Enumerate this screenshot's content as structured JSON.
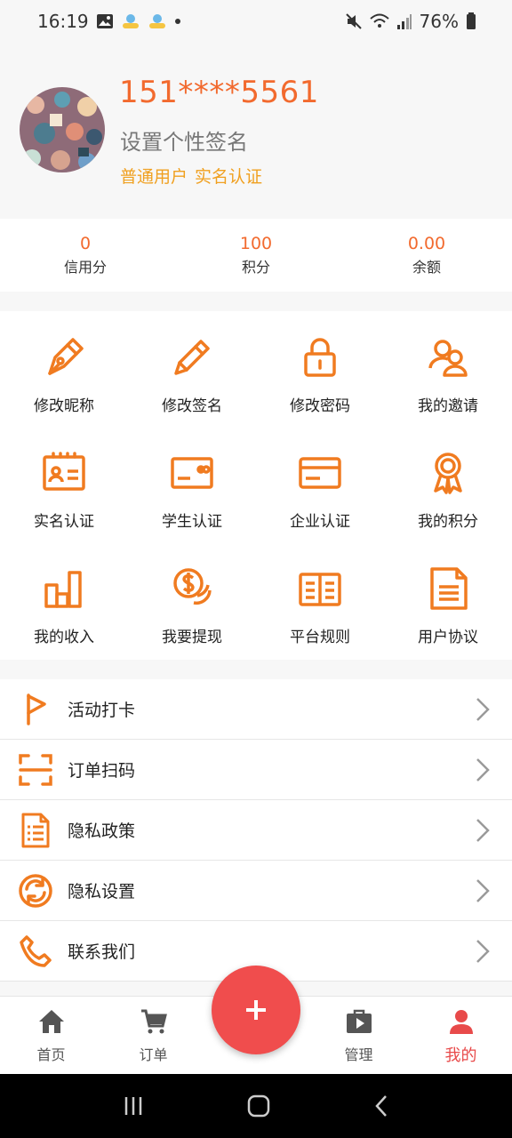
{
  "status_bar": {
    "time": "16:19",
    "battery": "76%"
  },
  "profile": {
    "phone": "151****5561",
    "signature": "设置个性签名",
    "user_type": "普通用户",
    "verify": "实名认证"
  },
  "stats": [
    {
      "value": "0",
      "label": "信用分"
    },
    {
      "value": "100",
      "label": "积分"
    },
    {
      "value": "0.00",
      "label": "余额"
    }
  ],
  "grid": [
    {
      "label": "修改昵称",
      "icon": "pen-nib-icon"
    },
    {
      "label": "修改签名",
      "icon": "pencil-icon"
    },
    {
      "label": "修改密码",
      "icon": "lock-icon"
    },
    {
      "label": "我的邀请",
      "icon": "users-icon"
    },
    {
      "label": "实名认证",
      "icon": "id-card-icon"
    },
    {
      "label": "学生认证",
      "icon": "student-card-icon"
    },
    {
      "label": "企业认证",
      "icon": "credit-card-icon"
    },
    {
      "label": "我的积分",
      "icon": "medal-icon"
    },
    {
      "label": "我的收入",
      "icon": "bar-chart-icon"
    },
    {
      "label": "我要提现",
      "icon": "coins-icon"
    },
    {
      "label": "平台规则",
      "icon": "book-icon"
    },
    {
      "label": "用户协议",
      "icon": "document-icon"
    }
  ],
  "list": [
    {
      "label": "活动打卡",
      "icon": "flag-icon"
    },
    {
      "label": "订单扫码",
      "icon": "scan-icon"
    },
    {
      "label": "隐私政策",
      "icon": "policy-doc-icon"
    },
    {
      "label": "隐私设置",
      "icon": "refresh-icon"
    },
    {
      "label": "联系我们",
      "icon": "phone-icon"
    }
  ],
  "tabbar": [
    {
      "label": "首页",
      "icon": "home-icon"
    },
    {
      "label": "订单",
      "icon": "cart-icon"
    },
    {
      "label": "管理",
      "icon": "briefcase-play-icon"
    },
    {
      "label": "我的",
      "icon": "person-icon"
    }
  ],
  "colors": {
    "accent": "#f26a2e",
    "badge": "#f0a020",
    "fab": "#f04d4d",
    "active_tab": "#e84a4a"
  }
}
